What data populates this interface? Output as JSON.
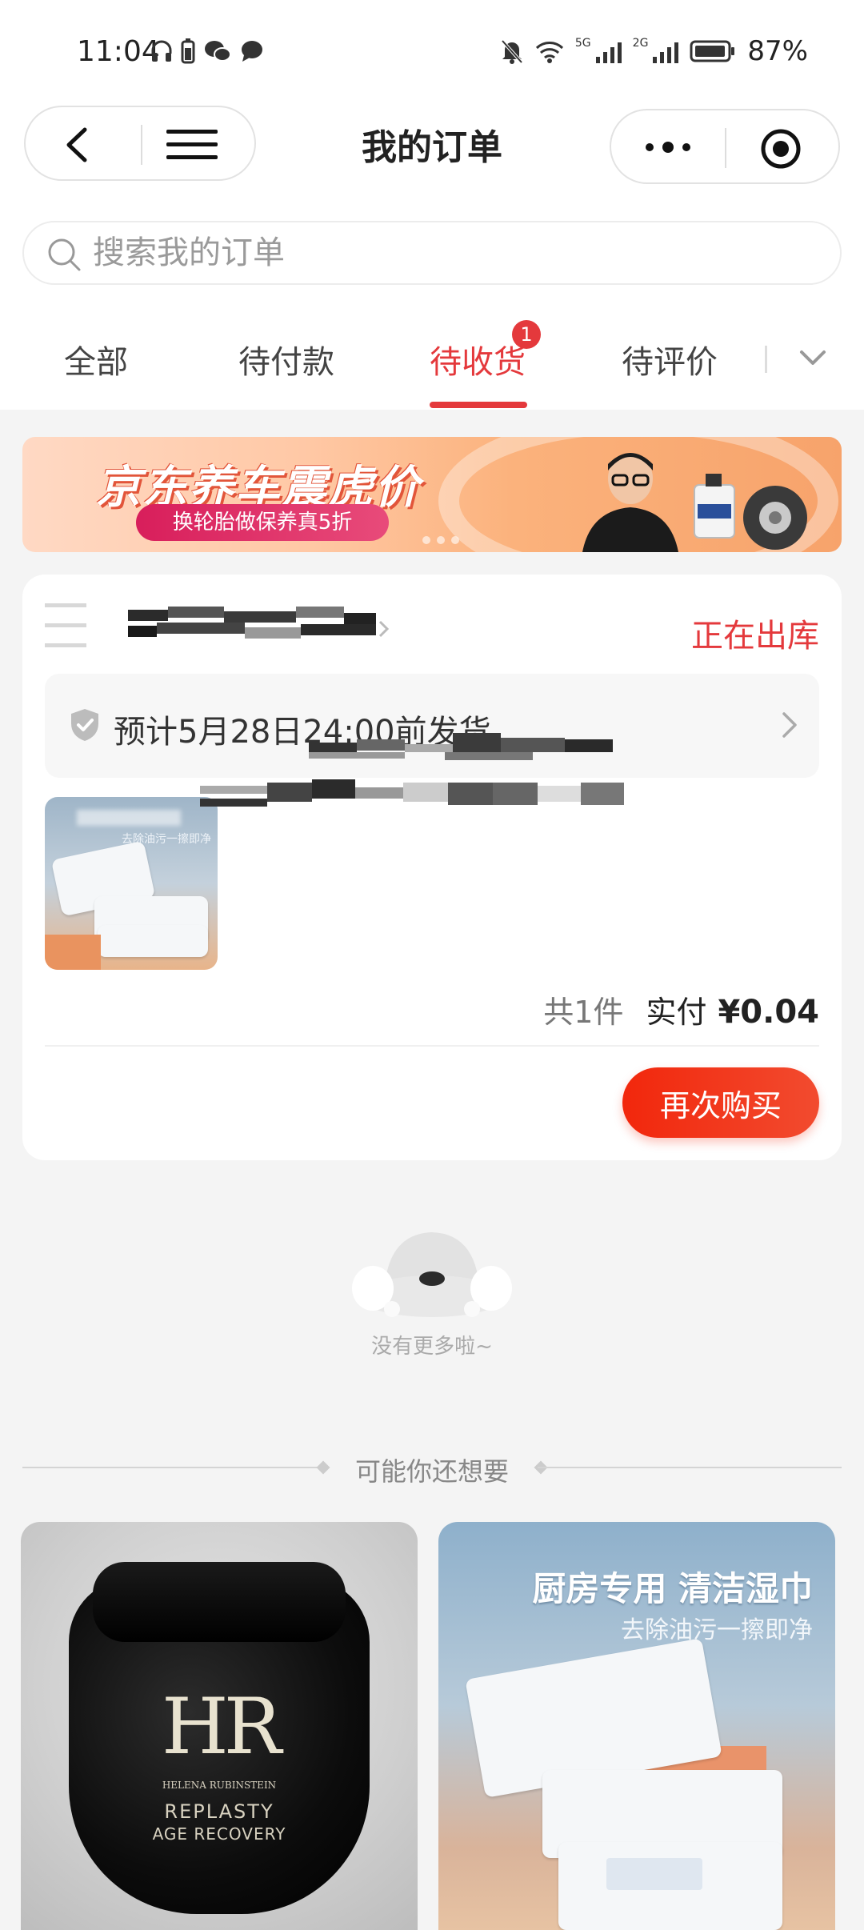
{
  "status_bar": {
    "time": "11:04",
    "battery_pct": "87%",
    "network_1": "5G",
    "network_2": "2G"
  },
  "header": {
    "title": "我的订单"
  },
  "search": {
    "placeholder": "搜索我的订单"
  },
  "tabs": [
    {
      "label": "全部",
      "active": false
    },
    {
      "label": "待付款",
      "active": false
    },
    {
      "label": "待收货",
      "active": true,
      "badge": "1"
    },
    {
      "label": "待评价",
      "active": false
    }
  ],
  "banner": {
    "title": "京东养车震虎价",
    "subtitle": "换轮胎做保养真5折"
  },
  "order": {
    "status": "正在出库",
    "shipping_note": "预计5月28日24:00前发货",
    "thumb_text": "去除油污一擦即净",
    "count": "共1件",
    "paid_label": "实付",
    "price": "¥0.04",
    "rebuy_label": "再次购买"
  },
  "no_more_text": "没有更多啦~",
  "recommend": {
    "title": "可能你还想要",
    "items": [
      {
        "logo": "HR",
        "maker": "HELENA RUBINSTEIN",
        "brand": "REPLASTY",
        "brand_sub": "AGE RECOVERY"
      },
      {
        "title": "厨房专用 清洁湿巾",
        "subtitle": "去除油污一擦即净"
      }
    ]
  },
  "colors": {
    "accent": "#e4393c",
    "button": "#f2270c",
    "background": "#f4f4f4"
  }
}
